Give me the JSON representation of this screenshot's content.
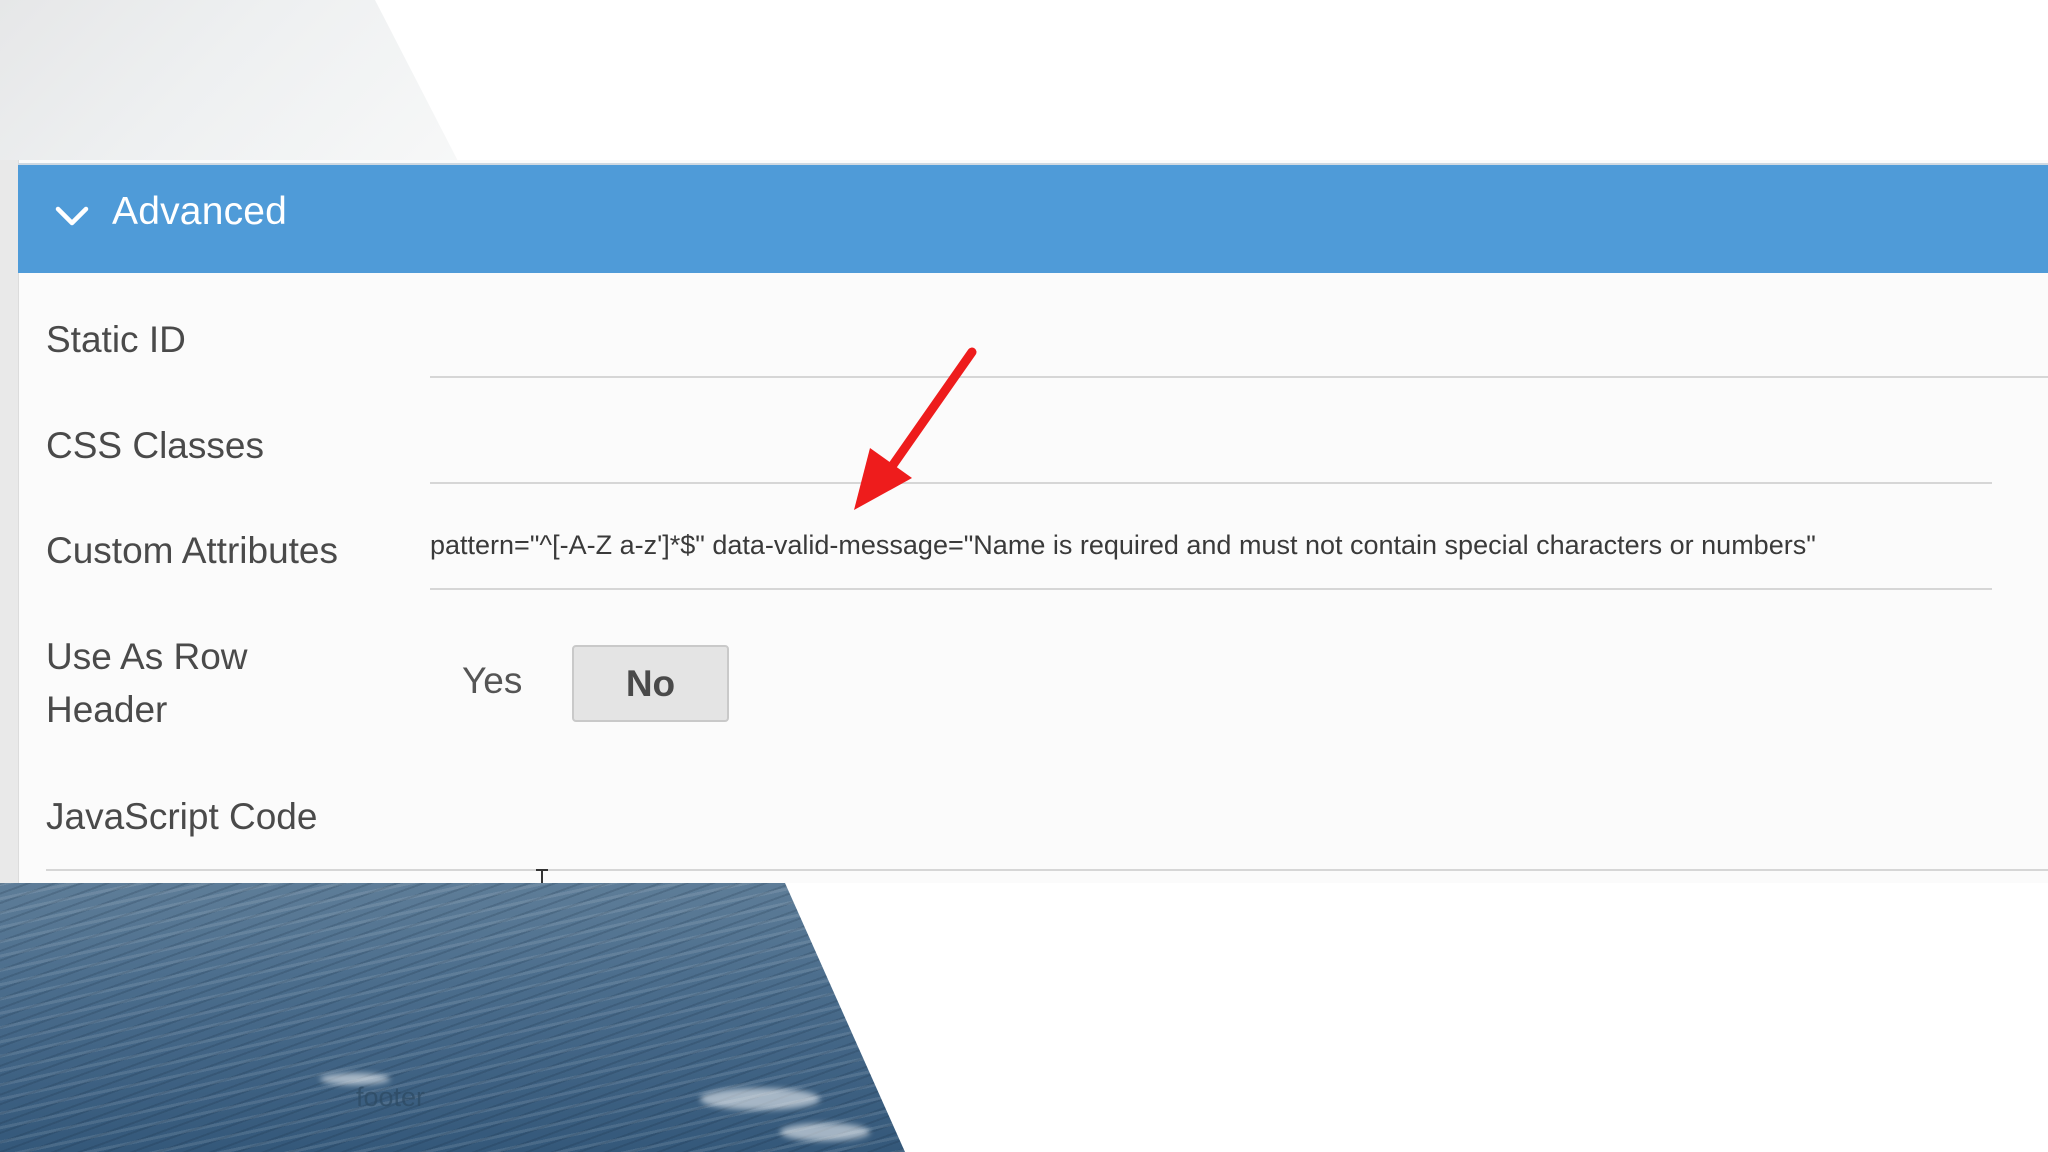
{
  "section": {
    "title": "Advanced",
    "toggle_icon": "chevron-down-icon"
  },
  "fields": {
    "static_id": {
      "label": "Static ID",
      "value": ""
    },
    "css_classes": {
      "label": "CSS Classes",
      "value": ""
    },
    "custom_attributes": {
      "label": "Custom Attributes",
      "value": "pattern=\"^[-A-Z a-z']*$\" data-valid-message=\"Name is required and must not contain special characters or numbers\""
    },
    "use_as_row_header": {
      "label_line1": "Use As Row",
      "label_line2": "Header",
      "options": [
        "Yes",
        "No"
      ],
      "selected": "No"
    },
    "javascript_code": {
      "label": "JavaScript Code"
    }
  },
  "footer": {
    "text": "footer"
  },
  "colors": {
    "header_bg": "#4f9bd8",
    "arrow": "#ee1c1c",
    "panel_bg": "#fbfbfb"
  }
}
